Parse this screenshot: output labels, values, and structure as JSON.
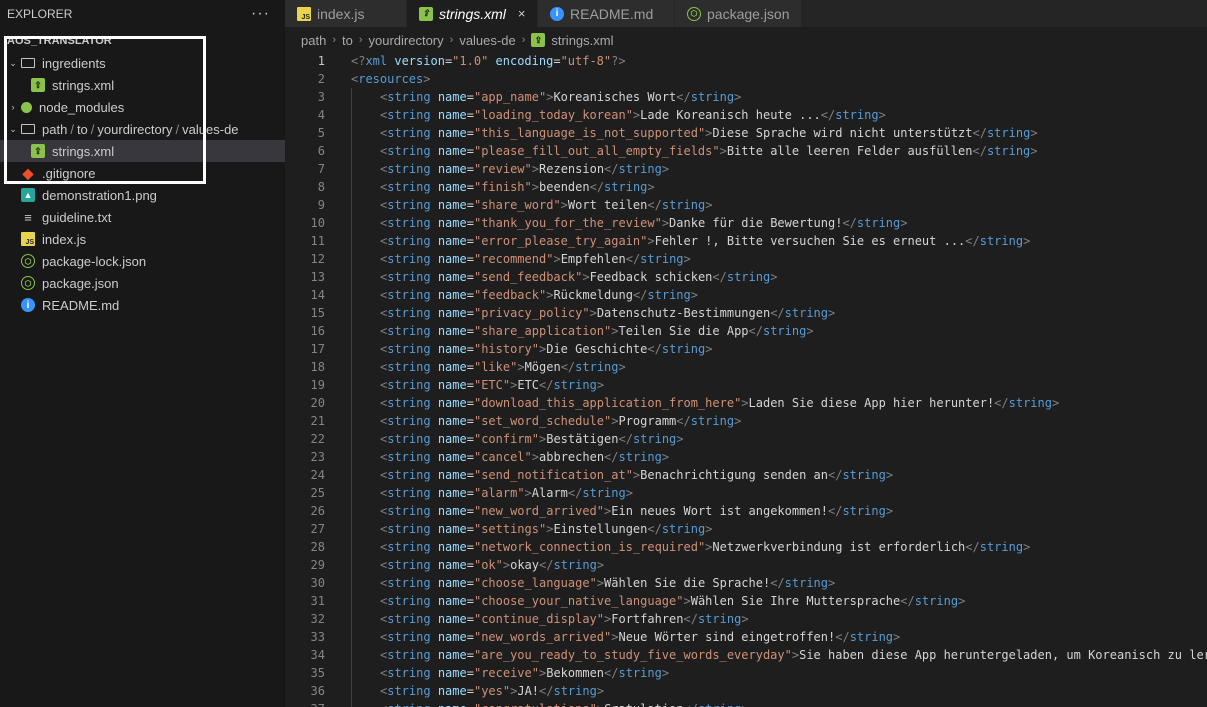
{
  "explorer": {
    "title": "EXPLORER",
    "more": "···",
    "project": "AOS_TRANSLATOR",
    "items": [
      {
        "label": "ingredients",
        "type": "folder-open",
        "depth": 0
      },
      {
        "label": "strings.xml",
        "type": "xml",
        "depth": 1
      },
      {
        "label": "node_modules",
        "type": "folder-closed",
        "depth": 0
      },
      {
        "label": "path",
        "path2": "to",
        "path3": "yourdirectory",
        "path4": "values-de",
        "type": "folder-path",
        "depth": 0
      },
      {
        "label": "strings.xml",
        "type": "xml",
        "depth": 1,
        "selected": true
      },
      {
        "label": ".gitignore",
        "type": "git",
        "depth": 0
      },
      {
        "label": "demonstration1.png",
        "type": "png",
        "depth": 0
      },
      {
        "label": "guideline.txt",
        "type": "txt",
        "depth": 0
      },
      {
        "label": "index.js",
        "type": "js",
        "depth": 0
      },
      {
        "label": "package-lock.json",
        "type": "json",
        "depth": 0
      },
      {
        "label": "package.json",
        "type": "json",
        "depth": 0
      },
      {
        "label": "README.md",
        "type": "info",
        "depth": 0
      }
    ]
  },
  "tabs": [
    {
      "label": "index.js",
      "icon": "js"
    },
    {
      "label": "strings.xml",
      "icon": "xml",
      "active": true,
      "close": "×"
    },
    {
      "label": "README.md",
      "icon": "info"
    },
    {
      "label": "package.json",
      "icon": "json"
    }
  ],
  "breadcrumbs": [
    "path",
    "to",
    "yourdirectory",
    "values-de",
    "strings.xml"
  ],
  "editor": {
    "active_line": 1,
    "header": [
      {
        "n": "1",
        "decl": "<?xml version=\"1.0\" encoding=\"utf-8\"?>"
      },
      {
        "n": "2",
        "open": "resources"
      }
    ],
    "entries": [
      {
        "n": "3",
        "name": "app_name",
        "value": "Koreanisches Wort"
      },
      {
        "n": "4",
        "name": "loading_today_korean",
        "value": "Lade Koreanisch heute ..."
      },
      {
        "n": "5",
        "name": "this_language_is_not_supported",
        "value": "Diese Sprache wird nicht unterstützt"
      },
      {
        "n": "6",
        "name": "please_fill_out_all_empty_fields",
        "value": "Bitte alle leeren Felder ausfüllen"
      },
      {
        "n": "7",
        "name": "review",
        "value": "Rezension"
      },
      {
        "n": "8",
        "name": "finish",
        "value": "beenden"
      },
      {
        "n": "9",
        "name": "share_word",
        "value": "Wort teilen"
      },
      {
        "n": "10",
        "name": "thank_you_for_the_review",
        "value": "Danke für die Bewertung!"
      },
      {
        "n": "11",
        "name": "error_please_try_again",
        "value": "Fehler !, Bitte versuchen Sie es erneut ..."
      },
      {
        "n": "12",
        "name": "recommend",
        "value": "Empfehlen"
      },
      {
        "n": "13",
        "name": "send_feedback",
        "value": "Feedback schicken"
      },
      {
        "n": "14",
        "name": "feedback",
        "value": "Rückmeldung"
      },
      {
        "n": "15",
        "name": "privacy_policy",
        "value": "Datenschutz-Bestimmungen"
      },
      {
        "n": "16",
        "name": "share_application",
        "value": "Teilen Sie die App"
      },
      {
        "n": "17",
        "name": "history",
        "value": "Die Geschichte"
      },
      {
        "n": "18",
        "name": "like",
        "value": "Mögen"
      },
      {
        "n": "19",
        "name": "ETC",
        "value": "ETC"
      },
      {
        "n": "20",
        "name": "download_this_application_from_here",
        "value": "Laden Sie diese App hier herunter!"
      },
      {
        "n": "21",
        "name": "set_word_schedule",
        "value": "Programm"
      },
      {
        "n": "22",
        "name": "confirm",
        "value": "Bestätigen"
      },
      {
        "n": "23",
        "name": "cancel",
        "value": "abbrechen"
      },
      {
        "n": "24",
        "name": "send_notification_at",
        "value": "Benachrichtigung senden an"
      },
      {
        "n": "25",
        "name": "alarm",
        "value": "Alarm"
      },
      {
        "n": "26",
        "name": "new_word_arrived",
        "value": "Ein neues Wort ist angekommen!"
      },
      {
        "n": "27",
        "name": "settings",
        "value": "Einstellungen"
      },
      {
        "n": "28",
        "name": "network_connection_is_required",
        "value": "Netzwerkverbindung ist erforderlich"
      },
      {
        "n": "29",
        "name": "ok",
        "value": "okay"
      },
      {
        "n": "30",
        "name": "choose_language",
        "value": "Wählen Sie die Sprache!"
      },
      {
        "n": "31",
        "name": "choose_your_native_language",
        "value": "Wählen Sie Ihre Muttersprache"
      },
      {
        "n": "32",
        "name": "continue_display",
        "value": "Fortfahren"
      },
      {
        "n": "33",
        "name": "new_words_arrived",
        "value": "Neue Wörter sind eingetroffen!"
      },
      {
        "n": "34",
        "name": "are_you_ready_to_study_five_words_everyday",
        "value": "Sie haben diese App heruntergeladen, um Koreanisch zu lernen",
        "noclose": true
      },
      {
        "n": "35",
        "name": "receive",
        "value": "Bekommen"
      },
      {
        "n": "36",
        "name": "yes",
        "value": "JA!"
      },
      {
        "n": "37",
        "name": "congratulations",
        "value": "Gratulation"
      }
    ]
  },
  "colors": {
    "tag": "#569cd6",
    "attribute": "#9cdcfe",
    "string": "#ce9178",
    "text": "#d4d4d4",
    "highlight_box": "#ffffff"
  }
}
